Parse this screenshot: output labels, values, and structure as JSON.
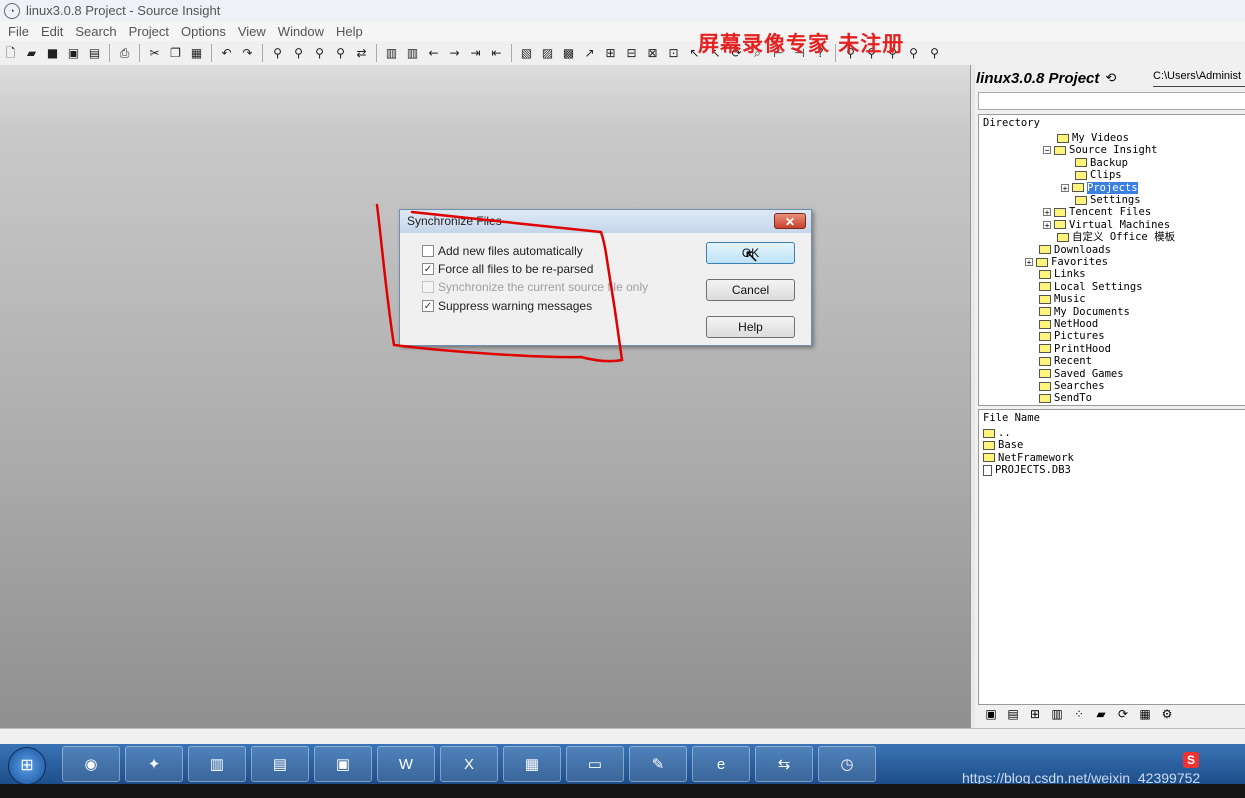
{
  "window": {
    "title": "linux3.0.8 Project - Source Insight",
    "app_icon": "app-icon"
  },
  "menu": [
    "File",
    "Edit",
    "Search",
    "Project",
    "Options",
    "View",
    "Window",
    "Help"
  ],
  "toolbar_icons": [
    "new-file-icon",
    "open-icon",
    "save-icon",
    "save-all-icon",
    "close-icon",
    "print-icon",
    "cut-icon",
    "copy-icon",
    "paste-icon",
    "undo-icon",
    "redo-icon",
    "find-icon",
    "find-next-icon",
    "find-prev-icon",
    "search-files-icon",
    "replace-icon",
    "bookmark-icon",
    "bookmark-list-icon",
    "back-icon",
    "forward-icon",
    "jump-icon",
    "jump-def-icon",
    "browse-icon",
    "context-icon",
    "window-icon",
    "relation-icon",
    "symbol-icon",
    "layout-icon",
    "cursor-icon",
    "sync-icon",
    "zoom-icon",
    "tree-icon",
    "help-icon"
  ],
  "watermark": "屏幕录像专家 未注册",
  "right_panel": {
    "title": "linux3.0.8 Project",
    "path": "C:\\Users\\Administ",
    "directory_label": "Directory",
    "tree": [
      {
        "label": "My Videos",
        "level": 2,
        "pm": ""
      },
      {
        "label": "Source Insight",
        "level": 2,
        "pm": "⊟"
      },
      {
        "label": "Backup",
        "level": 3,
        "pm": ""
      },
      {
        "label": "Clips",
        "level": 3,
        "pm": ""
      },
      {
        "label": "Projects",
        "level": 3,
        "pm": "+",
        "selected": true
      },
      {
        "label": "Settings",
        "level": 3,
        "pm": ""
      },
      {
        "label": "Tencent Files",
        "level": 2,
        "pm": "+"
      },
      {
        "label": "Virtual Machines",
        "level": 2,
        "pm": "+"
      },
      {
        "label": "自定义 Office 模板",
        "level": 2,
        "pm": ""
      },
      {
        "label": "Downloads",
        "level": 1,
        "pm": ""
      },
      {
        "label": "Favorites",
        "level": 1,
        "pm": "+"
      },
      {
        "label": "Links",
        "level": 1,
        "pm": ""
      },
      {
        "label": "Local Settings",
        "level": 1,
        "pm": ""
      },
      {
        "label": "Music",
        "level": 1,
        "pm": ""
      },
      {
        "label": "My Documents",
        "level": 1,
        "pm": ""
      },
      {
        "label": "NetHood",
        "level": 1,
        "pm": ""
      },
      {
        "label": "Pictures",
        "level": 1,
        "pm": ""
      },
      {
        "label": "PrintHood",
        "level": 1,
        "pm": ""
      },
      {
        "label": "Recent",
        "level": 1,
        "pm": ""
      },
      {
        "label": "Saved Games",
        "level": 1,
        "pm": ""
      },
      {
        "label": "Searches",
        "level": 1,
        "pm": ""
      },
      {
        "label": "SendTo",
        "level": 1,
        "pm": ""
      }
    ],
    "file_label": "File Name",
    "files": [
      {
        "label": "..",
        "kind": "folder"
      },
      {
        "label": "Base",
        "kind": "folder"
      },
      {
        "label": "NetFramework",
        "kind": "folder"
      },
      {
        "label": "PROJECTS.DB3",
        "kind": "file"
      }
    ],
    "bottom_icons": [
      "project-window-icon",
      "file-list-icon",
      "symbol-list-icon",
      "book-icon",
      "relation-icon",
      "open-project-icon",
      "sync-icon",
      "doc-icon",
      "settings-icon"
    ]
  },
  "dialog": {
    "title": "Synchronize Files",
    "close_label": "✕",
    "options": [
      {
        "label": "Add new files automatically",
        "checked": false,
        "disabled": false
      },
      {
        "label": "Force all files to be re-parsed",
        "checked": true,
        "disabled": false
      },
      {
        "label": "Synchronize the current source file only",
        "checked": false,
        "disabled": true
      },
      {
        "label": "Suppress warning messages",
        "checked": true,
        "disabled": false
      }
    ],
    "buttons": {
      "ok": "OK",
      "cancel": "Cancel",
      "help": "Help"
    }
  },
  "taskbar": {
    "apps": [
      "qq-icon",
      "bird-icon",
      "buildings-icon",
      "file-manager-icon",
      "virtualbox-icon",
      "word-icon",
      "excel-icon",
      "pdf-icon",
      "window-icon",
      "notepad-icon",
      "browser-icon",
      "network-icon",
      "clock-icon"
    ],
    "tray_label": "S",
    "url": "https://blog.csdn.net/weixin_42399752"
  },
  "colors": {
    "annotation": "#e00000",
    "selection": "#3b7fe0",
    "taskbar": "#2a62a0"
  }
}
